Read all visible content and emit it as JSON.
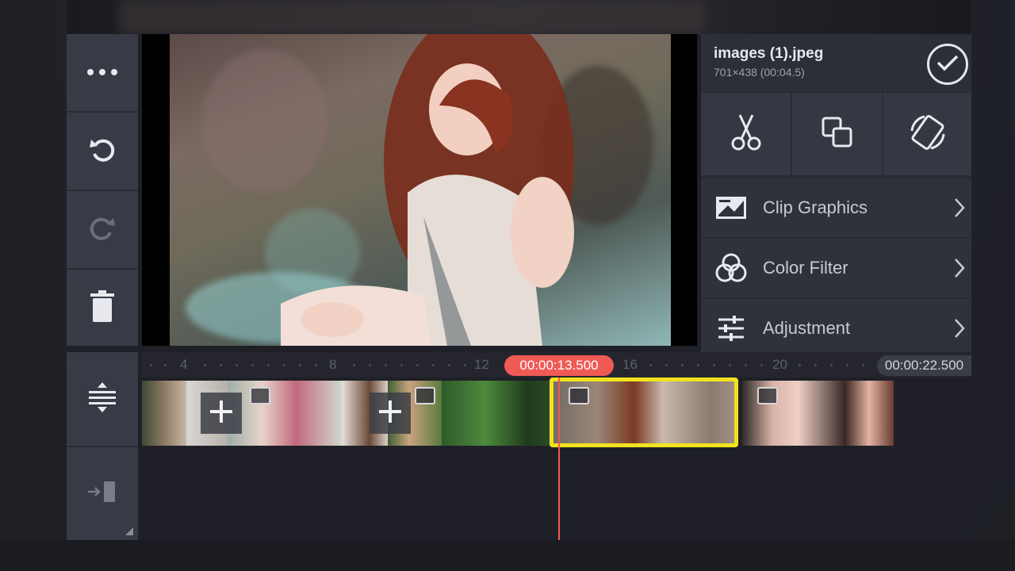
{
  "clip": {
    "filename": "images (1).jpeg",
    "info": "701×438 (00:04.5)"
  },
  "left_toolbar": {
    "items": [
      {
        "name": "more-icon"
      },
      {
        "name": "undo-icon"
      },
      {
        "name": "redo-icon"
      },
      {
        "name": "delete-icon"
      }
    ]
  },
  "right_panel": {
    "tools": [
      {
        "name": "scissors-icon"
      },
      {
        "name": "layer-copy-icon"
      },
      {
        "name": "rotate-icon"
      }
    ],
    "menu": [
      {
        "label": "Clip Graphics",
        "icon": "clip-graphics-icon"
      },
      {
        "label": "Color Filter",
        "icon": "color-filter-icon"
      },
      {
        "label": "Adjustment",
        "icon": "adjustment-icon"
      }
    ]
  },
  "timeline": {
    "ruler_labels": [
      "4",
      "8",
      "12",
      "16",
      "20"
    ],
    "current_time": "00:00:13.500",
    "end_time": "00:00:22.500"
  },
  "colors": {
    "accent_red": "#f05a55",
    "selection_yellow": "#f2e21e",
    "panel": "#2a2c35"
  }
}
